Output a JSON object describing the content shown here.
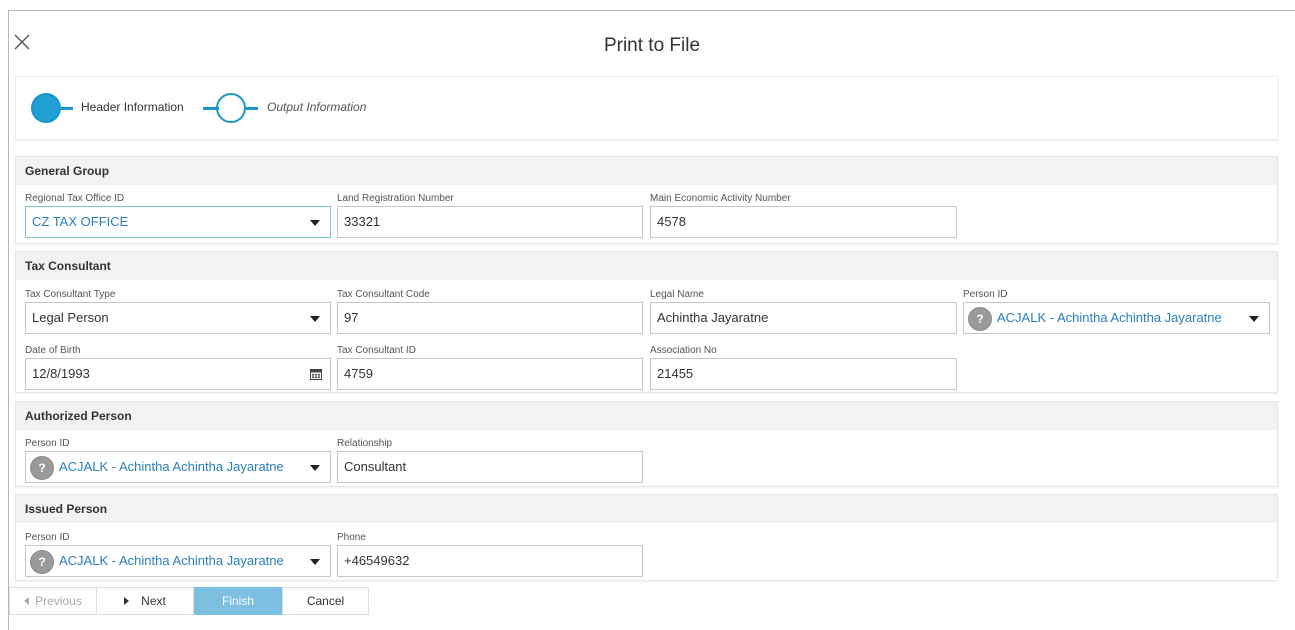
{
  "dialog": {
    "title": "Print to File",
    "close_icon": "close-icon"
  },
  "wizard": {
    "steps": [
      {
        "label": "Header Information",
        "state": "active"
      },
      {
        "label": "Output Information",
        "state": "inactive"
      }
    ],
    "accent": "#1f96c7"
  },
  "general_group": {
    "title": "General Group",
    "regional_tax_office": {
      "label": "Regional Tax Office ID",
      "value": "CZ TAX OFFICE"
    },
    "land_registration": {
      "label": "Land Registration Number",
      "value": "33321"
    },
    "main_economic_activity": {
      "label": "Main Economic Activity Number",
      "value": "4578"
    }
  },
  "tax_consultant": {
    "title": "Tax Consultant",
    "type": {
      "label": "Tax Consultant Type",
      "value": "Legal Person"
    },
    "code": {
      "label": "Tax Consultant Code",
      "value": "97"
    },
    "legal_name": {
      "label": "Legal Name",
      "value": "Achintha Jayaratne"
    },
    "person_id": {
      "label": "Person ID",
      "value": "ACJALK - Achintha Achintha Jayaratne"
    },
    "date_of_birth": {
      "label": "Date of Birth",
      "value": "12/8/1993"
    },
    "consultant_id": {
      "label": "Tax Consultant ID",
      "value": "4759"
    },
    "association_no": {
      "label": "Association No",
      "value": "21455"
    }
  },
  "authorized_person": {
    "title": "Authorized Person",
    "person_id": {
      "label": "Person ID",
      "value": "ACJALK - Achintha Achintha Jayaratne"
    },
    "relationship": {
      "label": "Relationship",
      "value": "Consultant"
    }
  },
  "issued_person": {
    "title": "Issued Person",
    "person_id": {
      "label": "Person ID",
      "value": "ACJALK - Achintha Achintha Jayaratne"
    },
    "phone": {
      "label": "Phone",
      "value": "+46549632"
    }
  },
  "footer": {
    "previous": "Previous",
    "next": "Next",
    "finish": "Finish",
    "cancel": "Cancel"
  },
  "colors": {
    "link": "#2a7fb8",
    "finish_button": "#7dbfe0",
    "section_header": "#f2f2f2"
  }
}
